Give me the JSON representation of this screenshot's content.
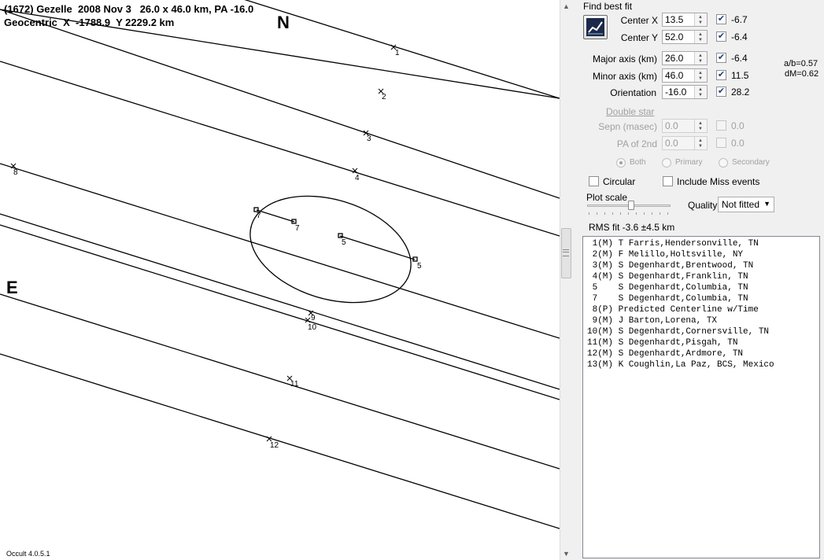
{
  "plot": {
    "title_line1": "(1672) Gezelle  2008 Nov 3   26.0 x 46.0 km, PA -16.0",
    "title_line2": "Geocentric  X  -1788.9  Y 2229.2 km",
    "north_label": "N",
    "east_label": "E",
    "version": "Occult 4.0.5.1",
    "chord_labels": [
      "1",
      "2",
      "3",
      "4",
      "5",
      "5",
      "7",
      "7",
      "8",
      "9",
      "10",
      "11",
      "12"
    ]
  },
  "panel": {
    "find_best_fit_label": "Find best fit",
    "center_x": {
      "label": "Center X",
      "value": "13.5",
      "checked": true,
      "result": "-6.7"
    },
    "center_y": {
      "label": "Center Y",
      "value": "52.0",
      "checked": true,
      "result": "-6.4"
    },
    "major_axis": {
      "label": "Major axis (km)",
      "value": "26.0",
      "checked": true,
      "result": "-6.4"
    },
    "minor_axis": {
      "label": "Minor axis (km)",
      "value": "46.0",
      "checked": true,
      "result": "11.5"
    },
    "orientation": {
      "label": "Orientation",
      "value": "-16.0",
      "checked": true,
      "result": "28.2"
    },
    "ab_ratio": "a/b=0.57",
    "dm": "dM=0.62",
    "double_star_label": "Double star",
    "sepn": {
      "label": "Sepn (masec)",
      "value": "0.0",
      "result": "0.0"
    },
    "pa2nd": {
      "label": "PA of 2nd",
      "value": "0.0",
      "result": "0.0"
    },
    "radio_both": "Both",
    "radio_primary": "Primary",
    "radio_secondary": "Secondary",
    "circular_label": "Circular",
    "include_miss_label": "Include Miss events",
    "plot_scale_label": "Plot scale",
    "plot_scale_value": 0.5,
    "quality_label": "Quality",
    "quality_value": "Not fitted",
    "rms_fit": "RMS fit -3.6 ±4.5 km"
  },
  "observers": [
    " 1(M) T Farris,Hendersonville, TN",
    " 2(M) F Melillo,Holtsville, NY",
    " 3(M) S Degenhardt,Brentwood, TN",
    " 4(M) S Degenhardt,Franklin, TN",
    " 5    S Degenhardt,Columbia, TN",
    " 7    S Degenhardt,Columbia, TN",
    " 8(P) Predicted Centerline w/Time",
    " 9(M) J Barton,Lorena, TX",
    "10(M) S Degenhardt,Cornersville, TN",
    "11(M) S Degenhardt,Pisgah, TN",
    "12(M) S Degenhardt,Ardmore, TN",
    "13(M) K Coughlin,La Paz, BCS, Mexico"
  ]
}
